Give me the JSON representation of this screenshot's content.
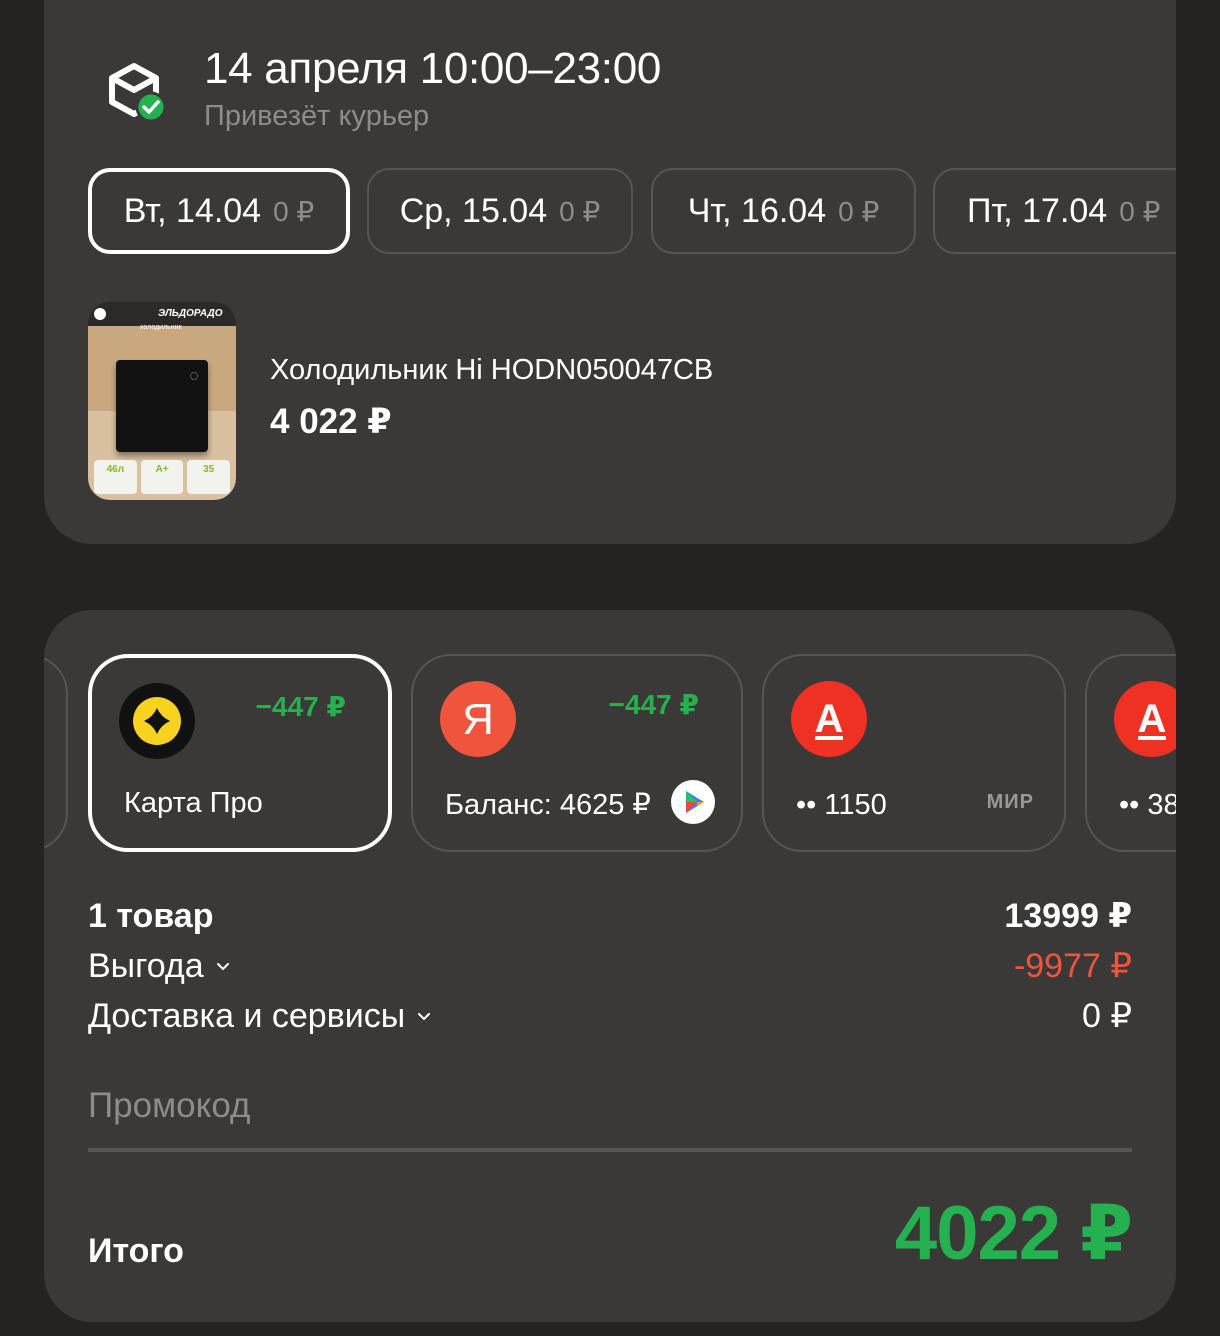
{
  "delivery": {
    "title": "14 апреля 10:00–23:00",
    "subtitle": "Привезёт курьер",
    "dates": [
      {
        "day": "Вт, 14.04",
        "price": "0 ₽",
        "selected": true
      },
      {
        "day": "Ср, 15.04",
        "price": "0 ₽",
        "selected": false
      },
      {
        "day": "Чт, 16.04",
        "price": "0 ₽",
        "selected": false
      },
      {
        "day": "Пт, 17.04",
        "price": "0 ₽",
        "selected": false
      }
    ]
  },
  "product": {
    "name": "Холодильник Hi HODN050047CB",
    "price": "4 022 ₽",
    "image": {
      "brand": "ЭЛЬДОРАДО",
      "subtitle": "холодильник",
      "badges": [
        "46л",
        "A+",
        "35"
      ]
    }
  },
  "payment": {
    "methods": [
      {
        "label": "Карта Про",
        "cashback": "−447 ₽",
        "logo_icon": "karta-pro-icon",
        "selected": true
      },
      {
        "label": "Баланс: 4625 ₽",
        "cashback": "−447 ₽",
        "logo_icon": "yandex-ya-icon",
        "logo_letter": "Я",
        "badge_icon": "play-badge-icon",
        "selected": false
      },
      {
        "label": "•• 1150",
        "cashback": "",
        "logo_icon": "alfa-bank-icon",
        "logo_letter": "А",
        "network": "МИР",
        "selected": false
      },
      {
        "label": "•• 38",
        "cashback": "",
        "logo_icon": "alfa-bank-icon",
        "logo_letter": "А",
        "selected": false
      }
    ]
  },
  "summary": {
    "items_label": "1 товар",
    "items_value": "13999 ₽",
    "discount_label": "Выгода",
    "discount_value": "-9977 ₽",
    "delivery_label": "Доставка и сервисы",
    "delivery_value": "0 ₽",
    "promo_placeholder": "Промокод",
    "total_label": "Итого",
    "total_value": "4022 ₽"
  },
  "colors": {
    "background": "#242322",
    "card": "#3a3937",
    "accent_green": "#25b14f",
    "discount_red": "#f0543c",
    "muted": "#8e8c89"
  }
}
